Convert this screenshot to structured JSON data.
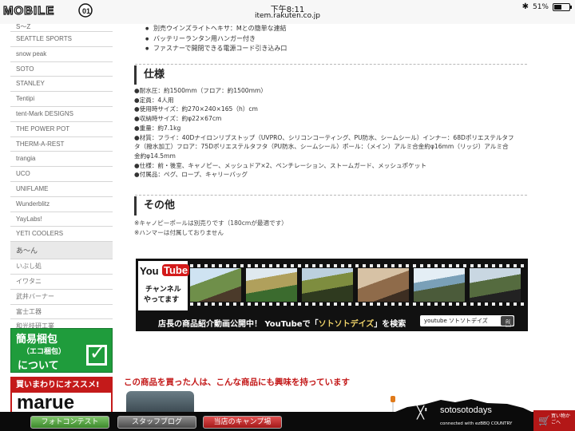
{
  "status_bar": {
    "logo_text": "MOBILE01",
    "time": "下午8:11",
    "url": "item.rakuten.co.jp",
    "battery": "51%",
    "battery_level": 0.51
  },
  "sidebar": {
    "top_partial": "S〜Z",
    "brands": [
      "SEATTLE SPORTS",
      "snow peak",
      "SOTO",
      "STANLEY",
      "Tentipi",
      "tent-Mark DESIGNS",
      "THE POWER POT",
      "THERM-A-REST",
      "trangia",
      "UCO",
      "UNIFLAME",
      "Wunderblitz",
      "YayLabs!",
      "YETI COOLERS"
    ],
    "section_a": "あ〜ん",
    "jp_brands": [
      "いぶし処",
      "イワタニ",
      "武井バーナー",
      "富士工器",
      "和光技研工業"
    ]
  },
  "banner_pack": {
    "line1": "簡易梱包",
    "line2": "（エコ梱包）",
    "line3": "について"
  },
  "banner_marue": {
    "top": "買いまわりにオススメ!",
    "brand": "marue"
  },
  "features": [
    "別売ウインズライトヘキサ：Mとの簡単な連結",
    "バッテリーランタン用ハンガー付き",
    "ファスナーで開閉できる電源コード引き込み口"
  ],
  "specs_section": {
    "title": "仕様",
    "items": [
      "●耐水圧：約1500mm（フロア：約1500mm）",
      "●定員：4人用",
      "●使用時サイズ：約270×240×165（h）cm",
      "●収納時サイズ：約φ22×67cm",
      "●重量：約7.1kg",
      "●材質：フライ：40Dナイロンリブストップ（UVPRO、シリコンコーティング、PU防水、シームシール）インナー：68Dポリエステルタフ",
      "タ（撥水加工）フロア：75Dポリエステルタフタ（PU防水、シームシール）ポール：（メイン）アルミ合金約φ16mm（リッジ）アルミ合",
      "金約φ14.5mm",
      "●仕様：前・後室、キャノピー、メッシュドア×2、ベンチレーション、ストームガード、メッシュポケット",
      "●付属品：ペグ、ロープ、キャリーバッグ"
    ]
  },
  "other_section": {
    "title": "その他",
    "notes": [
      "※キャノピーポールは別売りです（180cmが最適です）",
      "※ハンマーは付属しておりません"
    ]
  },
  "youtube_banner": {
    "logo_you": "You",
    "logo_tube": "Tube",
    "channel_line1": "チャンネル",
    "channel_line2": "やってます",
    "caption_pre": "店長の商品紹介動画公開中！ YouTubeで「",
    "caption_highlight": "ソトソトデイズ",
    "caption_post": "」を検索",
    "search_text": "youtube  ソトソトデイズ",
    "colors": {
      "red": "#d31a1a",
      "highlight": "#f1d46a"
    }
  },
  "recommend_heading": "この商品を買った人は、こんな商品にも興味を持っています",
  "bottom_bar": {
    "photo_contest": "フォトコンテスト",
    "staff_blog": "スタッフブログ",
    "camp_site": "当店のキャンプ場",
    "brand_name": "sotosotodays",
    "brand_sub": "connected with ezBBQ COUNTRY",
    "cart_label": "買い物かごへ"
  }
}
